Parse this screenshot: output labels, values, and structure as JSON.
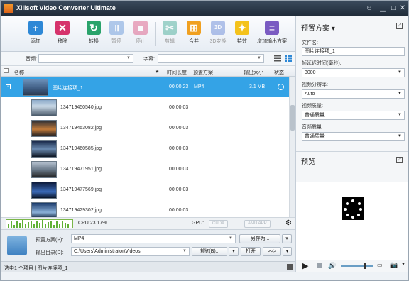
{
  "window": {
    "title": "Xilisoft Video Converter Ultimate"
  },
  "toolbar": {
    "add": "添加",
    "remove": "移除",
    "convert": "转换",
    "pause": "暂停",
    "stop": "停止",
    "clip": "剪辑",
    "merge": "合并",
    "convert3d": "3D变换",
    "effects": "特效",
    "add_profile": "增加输出方案"
  },
  "filters": {
    "audio_label": "音频:",
    "audio_value": "",
    "subtitle_label": "字幕:",
    "subtitle_value": ""
  },
  "list_header": {
    "name": "名称",
    "star": "★",
    "duration": "时间长度",
    "profile": "预置方案",
    "output_size": "输出大小",
    "status": "状态"
  },
  "rows": [
    {
      "name": "图片连接项_1",
      "duration": "00:00:23",
      "format": "MP4",
      "size": "3.1 MB",
      "selected": true
    },
    {
      "name": "134719450540.jpg",
      "duration": "00:00:03"
    },
    {
      "name": "134719453082.jpg",
      "duration": "00:00:03"
    },
    {
      "name": "134719460585.jpg",
      "duration": "00:00:03"
    },
    {
      "name": "134719471951.jpg",
      "duration": "00:00:03"
    },
    {
      "name": "134719477569.jpg",
      "duration": "00:00:03"
    },
    {
      "name": "134719429302.jpg",
      "duration": "00:00:03"
    }
  ],
  "cpu": {
    "label": "CPU:23.17%",
    "gpu_label": "GPU:",
    "cuda": "CUDA",
    "amd": "AMD APP"
  },
  "bottom": {
    "profile_label": "预置方案(P):",
    "profile_value": "MP4",
    "save_as": "另存为...",
    "output_label": "输出目录(D):",
    "output_value": "C:\\Users\\Administrator\\Videos",
    "browse": "浏览(B)...",
    "open": "打开",
    "more": ">>>"
  },
  "status": {
    "text": "选中1 个项目 | 图片连接项_1"
  },
  "right": {
    "profile_title": "预置方案",
    "filename_label": "文件名:",
    "filename_value": "图片连接项_1",
    "frame_delay_label": "帧延迟时间(毫秒):",
    "frame_delay_value": "3000",
    "resolution_label": "视频分辨率:",
    "resolution_value": "Auto",
    "video_quality_label": "视频质量:",
    "video_quality_value": "普通质量",
    "audio_quality_label": "音频质量:",
    "audio_quality_value": "普通质量",
    "preview_title": "预览"
  }
}
